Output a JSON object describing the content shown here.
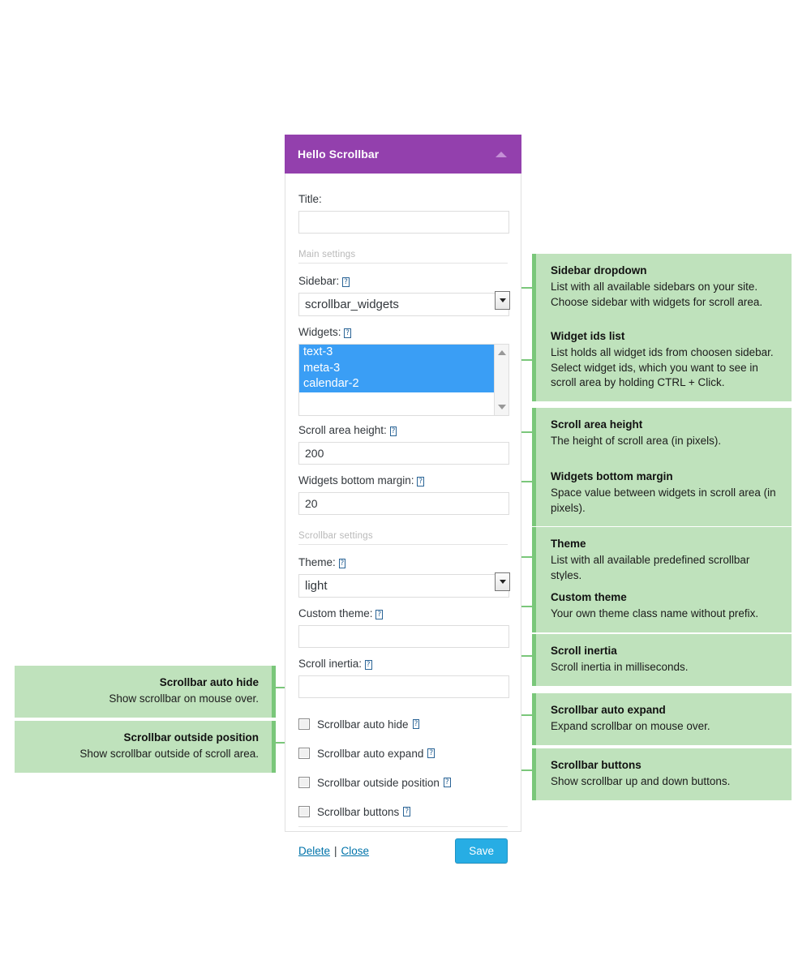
{
  "panel": {
    "header_title": "Hello Scrollbar",
    "collapse_icon": "triangle-up-icon",
    "fields": {
      "title": {
        "label": "Title:",
        "value": "",
        "placeholder": ""
      },
      "main_settings_header": "Main settings",
      "sidebar": {
        "label": "Sidebar:",
        "help": "?",
        "value": "scrollbar_widgets"
      },
      "widgets": {
        "label": "Widgets:",
        "help": "?",
        "options": [
          "text-3",
          "meta-3",
          "calendar-2"
        ],
        "selected": [
          "text-3",
          "meta-3",
          "calendar-2"
        ]
      },
      "scroll_area_height": {
        "label": "Scroll area height:",
        "help": "?",
        "value": "200"
      },
      "widgets_bottom_margin": {
        "label": "Widgets bottom margin:",
        "help": "?",
        "value": "20"
      },
      "scrollbar_settings_header": "Scrollbar settings",
      "theme": {
        "label": "Theme:",
        "help": "?",
        "value": "light"
      },
      "custom_theme": {
        "label": "Custom theme:",
        "help": "?",
        "value": ""
      },
      "scroll_inertia": {
        "label": "Scroll inertia:",
        "help": "?",
        "value": ""
      }
    },
    "checkboxes": [
      {
        "label": "Scrollbar auto hide",
        "help": "?",
        "checked": false
      },
      {
        "label": "Scrollbar auto expand",
        "help": "?",
        "checked": false
      },
      {
        "label": "Scrollbar outside position",
        "help": "?",
        "checked": false
      },
      {
        "label": "Scrollbar buttons",
        "help": "?",
        "checked": false
      }
    ],
    "footer": {
      "delete_label": "Delete",
      "separator": "|",
      "close_label": "Close",
      "save_label": "Save"
    }
  },
  "callouts_right": [
    {
      "title": "Sidebar dropdown",
      "body": "List with all available sidebars on your site. Choose sidebar with widgets for scroll area."
    },
    {
      "title": "Widget ids list",
      "body": "List holds all widget ids from choosen sidebar. Select widget ids, which you want to see in scroll area by holding CTRL + Click."
    },
    {
      "title": "Scroll area height",
      "body": "The height of scroll area (in pixels)."
    },
    {
      "title": "Widgets bottom margin",
      "body": "Space value between widgets in scroll area (in pixels)."
    },
    {
      "title": "Theme",
      "body": "List with all available predefined scrollbar styles."
    },
    {
      "title": "Custom theme",
      "body": "Your own theme class name without prefix."
    },
    {
      "title": "Scroll inertia",
      "body": "Scroll inertia in milliseconds."
    },
    {
      "title": "Scrollbar auto expand",
      "body": "Expand scrollbar on mouse over."
    },
    {
      "title": "Scrollbar buttons",
      "body": "Show scrollbar up and down buttons."
    }
  ],
  "callouts_left": [
    {
      "title": "Scrollbar auto hide",
      "body": "Show scrollbar on mouse over."
    },
    {
      "title": "Scrollbar outside position",
      "body": "Show scrollbar outside of scroll area."
    }
  ],
  "colors": {
    "header_purple": "#9340ad",
    "callout_green": "#bfe2bc",
    "callout_accent": "#7ac77a",
    "selection_blue": "#3a9ef5",
    "save_blue": "#27ade4",
    "link_blue": "#0073aa"
  }
}
